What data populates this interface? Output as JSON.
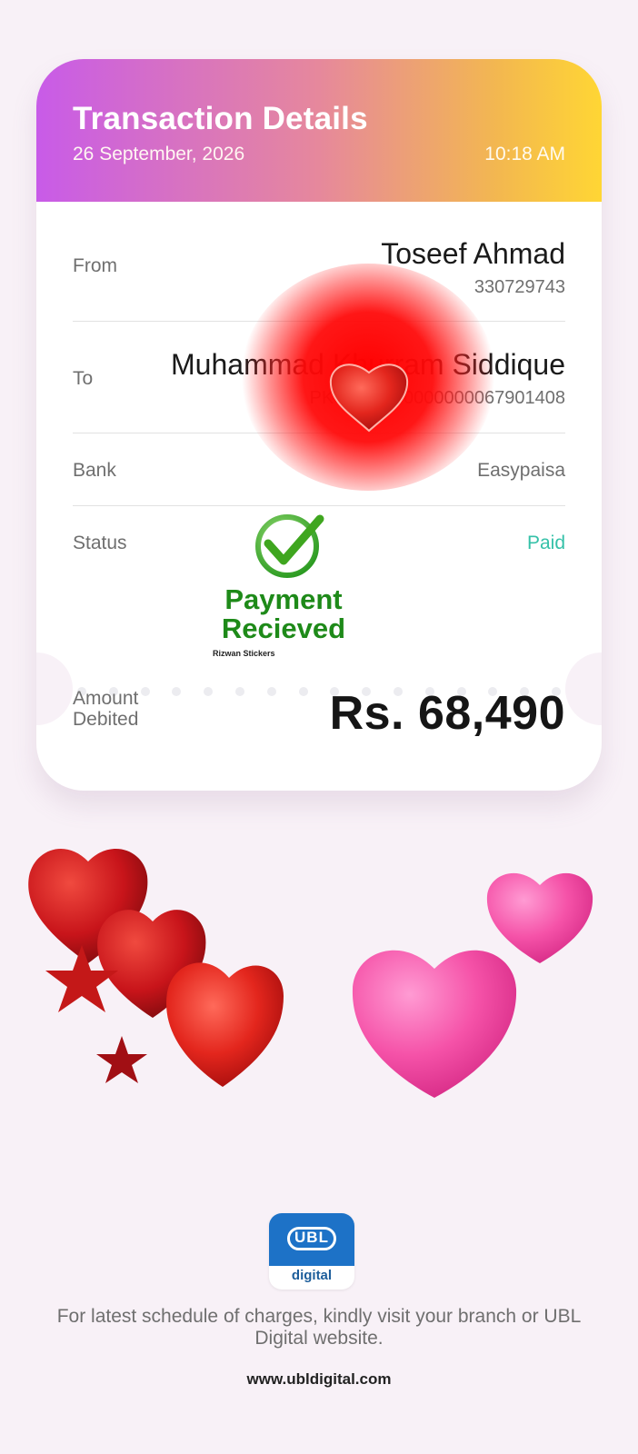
{
  "header": {
    "title": "Transaction Details",
    "date": "26 September, 2026",
    "time": "10:18 AM"
  },
  "details": {
    "from": {
      "label": "From",
      "name": "Toseef Ahmad",
      "account": "330729743"
    },
    "to": {
      "label": "To",
      "name": "Muhammad Khurram Siddique",
      "account": "PK86TMFB0000000067901408"
    },
    "bank": {
      "label": "Bank",
      "value": "Easypaisa"
    },
    "status": {
      "label": "Status",
      "value": "Paid"
    }
  },
  "amount": {
    "label_line1": "Amount",
    "label_line2": "Debited",
    "value": "Rs. 68,490"
  },
  "sticker": {
    "line1": "Payment",
    "line2": "Recieved",
    "credit": "Rizwan Stickers"
  },
  "brand": {
    "logo_text": "UBL",
    "logo_sub": "digital"
  },
  "footer": {
    "note": "For latest schedule of charges, kindly visit your branch or UBL Digital website.",
    "url": "www.ubldigital.com"
  },
  "colors": {
    "header_gradient": [
      "#c85be8",
      "#e6889c",
      "#ffd634"
    ],
    "paid": "#35c1a8",
    "ubl_blue": "#1d72c7"
  },
  "icons": [
    "check-circle-icon",
    "red-heart-icon",
    "pink-heart-icon",
    "ubl-digital-logo"
  ]
}
